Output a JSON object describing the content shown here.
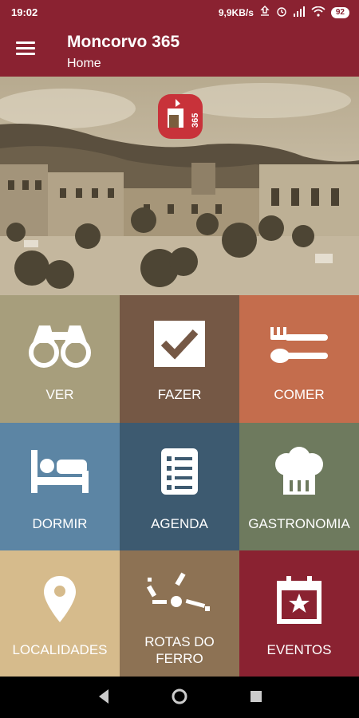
{
  "status_bar": {
    "time": "19:02",
    "network_speed": "9,9KB/s",
    "battery": "92"
  },
  "app_bar": {
    "title": "Moncorvo 365",
    "subtitle": "Home"
  },
  "logo": {
    "text": "365"
  },
  "tiles": [
    {
      "label": "VER",
      "icon": "binoculars-icon",
      "color": "#a79e7c"
    },
    {
      "label": "FAZER",
      "icon": "checkmark-icon",
      "color": "#755845"
    },
    {
      "label": "COMER",
      "icon": "fork-spoon-icon",
      "color": "#c46d4d"
    },
    {
      "label": "DORMIR",
      "icon": "bed-icon",
      "color": "#5c85a4"
    },
    {
      "label": "AGENDA",
      "icon": "list-icon",
      "color": "#3d5a70"
    },
    {
      "label": "GASTRONOMIA",
      "icon": "chef-hat-icon",
      "color": "#6e7a5e"
    },
    {
      "label": "LOCALIDADES",
      "icon": "location-pin-icon",
      "color": "#d6bb8c"
    },
    {
      "label": "ROTAS DO FERRO",
      "label_line1": "ROTAS DO",
      "label_line2": "FERRO",
      "icon": "route-icon",
      "color": "#8d7254"
    },
    {
      "label": "EVENTOS",
      "icon": "calendar-star-icon",
      "color": "#8a2231"
    }
  ],
  "colors": {
    "primary": "#8a2231"
  }
}
